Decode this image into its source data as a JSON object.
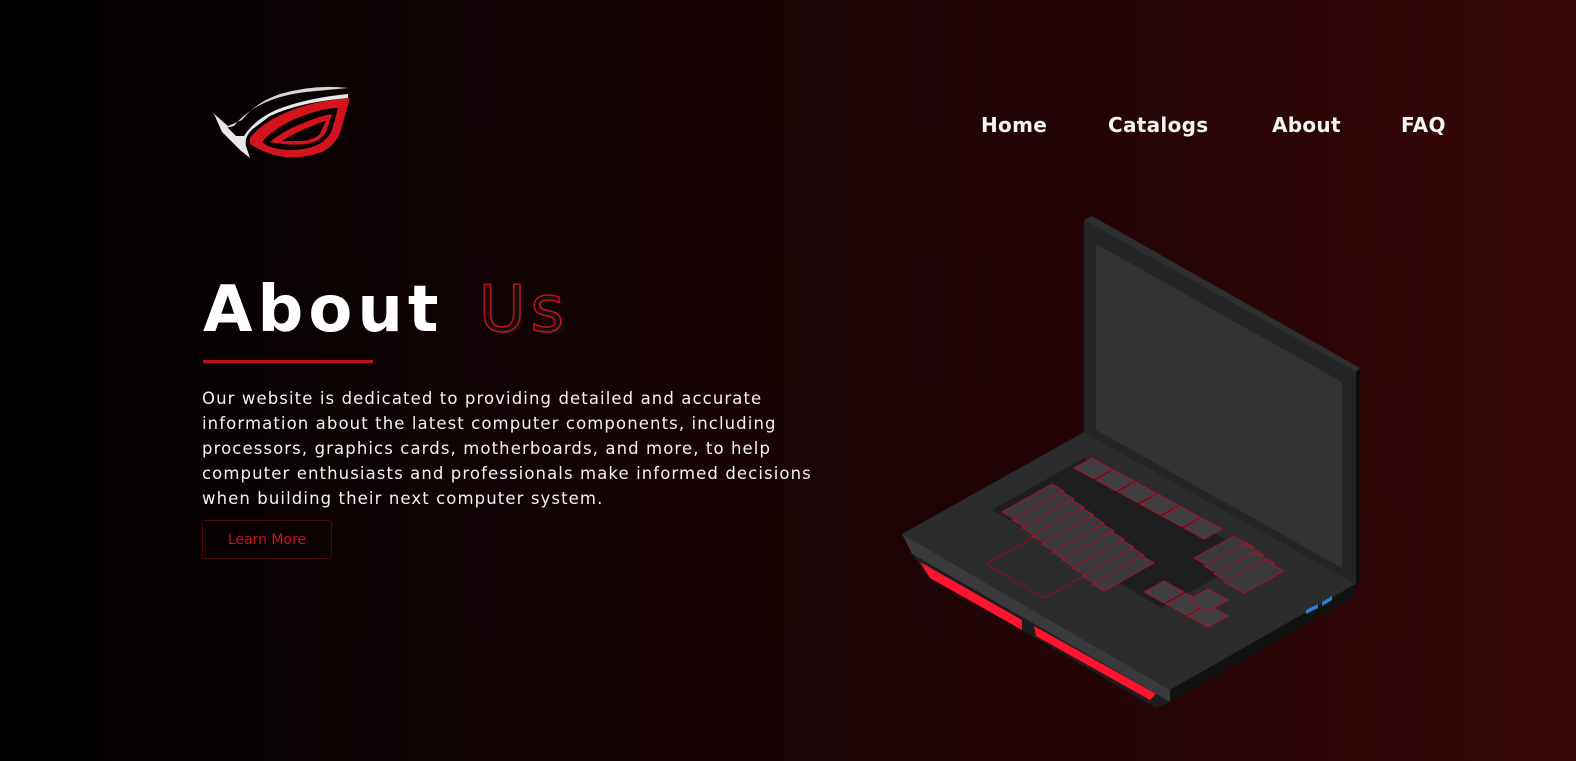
{
  "brand": {
    "logo_icon": "rog-eye-logo",
    "accent_color": "#c20f1b",
    "background_start": "#000000",
    "background_end": "#360808"
  },
  "nav": {
    "items": [
      {
        "label": "Home"
      },
      {
        "label": "Catalogs"
      },
      {
        "label": "About"
      },
      {
        "label": "FAQ"
      }
    ]
  },
  "hero": {
    "title_primary": "About",
    "title_accent": "Us",
    "description": "Our website is dedicated to providing detailed and accurate information about the latest computer components, including processors, graphics cards, motherboards, and more, to help computer enthusiasts and professionals make informed decisions when building their next computer system.",
    "cta_label": "Learn More"
  },
  "illustration": {
    "icon": "gaming-laptop-illustration"
  }
}
